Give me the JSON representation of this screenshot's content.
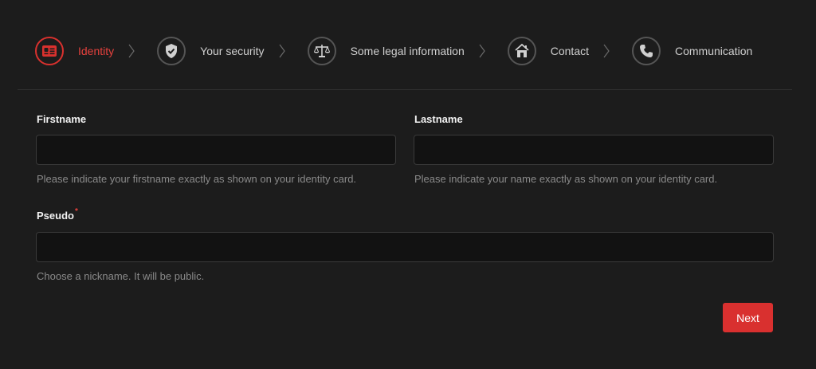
{
  "stepper": {
    "steps": [
      {
        "label": "Identity",
        "icon": "id-card-icon",
        "active": true
      },
      {
        "label": "Your security",
        "icon": "shield-check-icon",
        "active": false
      },
      {
        "label": "Some legal information",
        "icon": "scales-icon",
        "active": false
      },
      {
        "label": "Contact",
        "icon": "house-icon",
        "active": false
      },
      {
        "label": "Communication",
        "icon": "phone-icon",
        "active": false
      }
    ],
    "active_color": "#d9312e"
  },
  "form": {
    "firstname": {
      "label": "Firstname",
      "value": "",
      "hint": "Please indicate your firstname exactly as shown on your identity card."
    },
    "lastname": {
      "label": "Lastname",
      "value": "",
      "hint": "Please indicate your name exactly as shown on your identity card."
    },
    "pseudo": {
      "label": "Pseudo",
      "required_mark": "*",
      "value": "",
      "hint": "Choose a nickname. It will be public."
    },
    "next_label": "Next"
  }
}
